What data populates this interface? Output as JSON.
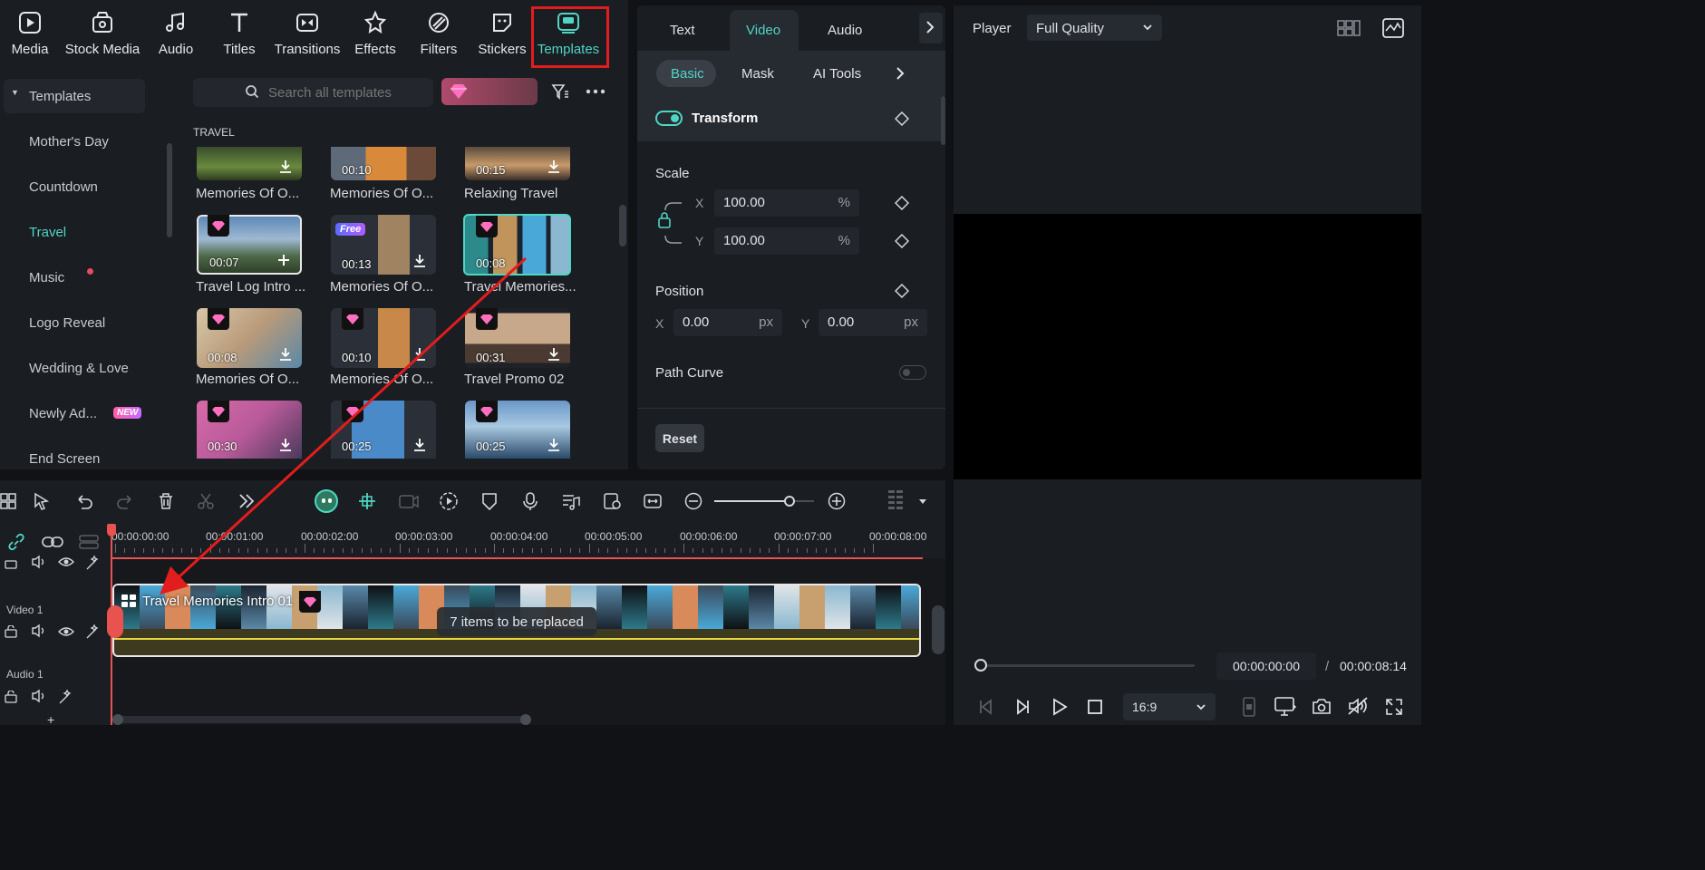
{
  "toolbar": {
    "items": [
      {
        "label": "Media",
        "icon": "media-icon"
      },
      {
        "label": "Stock Media",
        "icon": "stock-media-icon"
      },
      {
        "label": "Audio",
        "icon": "audio-icon"
      },
      {
        "label": "Titles",
        "icon": "titles-icon"
      },
      {
        "label": "Transitions",
        "icon": "transitions-icon"
      },
      {
        "label": "Effects",
        "icon": "effects-icon"
      },
      {
        "label": "Filters",
        "icon": "filters-icon"
      },
      {
        "label": "Stickers",
        "icon": "stickers-icon"
      },
      {
        "label": "Templates",
        "icon": "templates-icon"
      }
    ],
    "active": "Templates",
    "accent_color": "#4fd6c4",
    "highlight_color": "#e21d1d"
  },
  "categories": {
    "header": "Templates",
    "items": [
      "Mother's Day",
      "Countdown",
      "Travel",
      "Music",
      "Logo Reveal",
      "Wedding & Love",
      "Newly Ad...",
      "End Screen"
    ],
    "active": "Travel",
    "new_badge": "NEW"
  },
  "search": {
    "placeholder": "Search all templates"
  },
  "grid": {
    "section_label": "TRAVEL",
    "rows": [
      [
        {
          "title": "Memories Of O...",
          "duration": ""
        },
        {
          "title": "Memories Of O...",
          "duration": "00:10"
        },
        {
          "title": "Relaxing Travel",
          "duration": "00:15"
        }
      ],
      [
        {
          "title": "Travel Log Intro ...",
          "duration": "00:07"
        },
        {
          "title": "Memories Of O...",
          "duration": "00:13",
          "badge": "Free"
        },
        {
          "title": "Travel Memories...",
          "duration": "00:08"
        }
      ],
      [
        {
          "title": "Memories Of O...",
          "duration": "00:08"
        },
        {
          "title": "Memories Of O...",
          "duration": "00:10"
        },
        {
          "title": "Travel Promo 02",
          "duration": "00:31"
        }
      ],
      [
        {
          "title": "",
          "duration": "00:30"
        },
        {
          "title": "",
          "duration": "00:25"
        },
        {
          "title": "",
          "duration": "00:25"
        }
      ]
    ]
  },
  "properties": {
    "tabs": [
      "Text",
      "Video",
      "Audio"
    ],
    "active_tab": "Video",
    "subtabs": [
      "Basic",
      "Mask",
      "AI Tools"
    ],
    "active_subtab": "Basic",
    "transform_label": "Transform",
    "scale_label": "Scale",
    "scale_x": "100.00",
    "scale_y": "100.00",
    "percent": "%",
    "position_label": "Position",
    "pos_x": "0.00",
    "pos_y": "0.00",
    "px": "px",
    "x_label": "X",
    "y_label": "Y",
    "path_curve_label": "Path Curve",
    "reset_label": "Reset"
  },
  "player": {
    "label": "Player",
    "quality": "Full Quality",
    "current_time": "00:00:00:00",
    "separator": "/",
    "total_time": "00:00:08:14",
    "aspect": "16:9"
  },
  "timeline": {
    "ticks": [
      "00:00:00:00",
      "00:00:01:00",
      "00:00:02:00",
      "00:00:03:00",
      "00:00:04:00",
      "00:00:05:00",
      "00:00:06:00",
      "00:00:07:00",
      "00:00:08:00"
    ],
    "video_track": "Video 1",
    "audio_track": "Audio 1",
    "clip_title": "Travel Memories Intro 01",
    "replace_tip": "7 items to be replaced",
    "zoom_level": 0.75
  }
}
